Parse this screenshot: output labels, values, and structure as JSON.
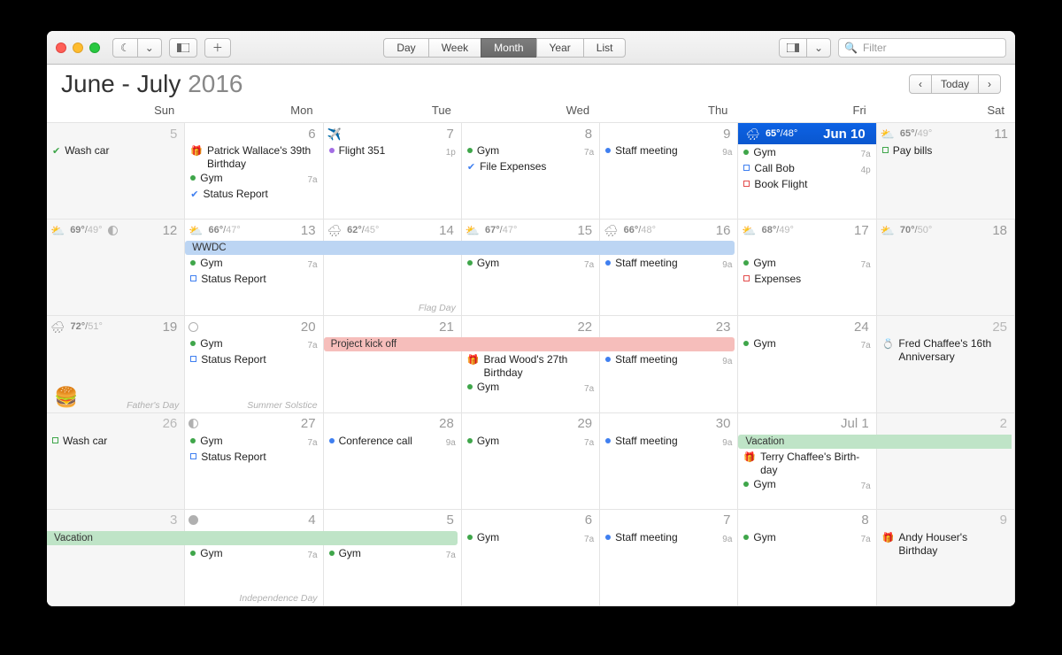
{
  "title": {
    "range": "June - July",
    "year": "2016"
  },
  "toolbar": {
    "views": [
      "Day",
      "Week",
      "Month",
      "Year",
      "List"
    ],
    "active_view": "Month",
    "search_placeholder": "Filter",
    "today_label": "Today"
  },
  "weekdays": [
    "Sun",
    "Mon",
    "Tue",
    "Wed",
    "Thu",
    "Fri",
    "Sat"
  ],
  "colors": {
    "green": "#3fa64a",
    "blue": "#3f7ff0",
    "red": "#e34b4b",
    "purple": "#a36de4",
    "wwdc": "#bcd5f3",
    "project": "#f6bebb",
    "vacation": "#bfe4c7",
    "today": "#0d62e4"
  },
  "spans": {
    "wwdc": {
      "label": "WWDC",
      "week": 1,
      "from": 1,
      "to": 4
    },
    "project": {
      "label": "Project kick off",
      "week": 2,
      "from": 2,
      "to": 4
    },
    "vacation1": {
      "label": "Vacation",
      "week": 3,
      "from": 5,
      "to": 6
    },
    "vacation2": {
      "label": "Vacation",
      "week": 4,
      "from": 0,
      "to": 2
    }
  },
  "weeks": [
    [
      {
        "day": "5",
        "weekend": true,
        "oom": true,
        "events": [
          {
            "k": "chk",
            "c": "green",
            "t": "Wash car"
          }
        ]
      },
      {
        "day": "6",
        "events": [
          {
            "k": "glyph",
            "c": "red",
            "g": "🎁",
            "t": "Patrick Wallace's 39th Birthday"
          },
          {
            "k": "dot",
            "c": "green",
            "t": "Gym",
            "time": "7a"
          },
          {
            "k": "chk",
            "c": "blue",
            "t": "Status Report"
          }
        ]
      },
      {
        "day": "7",
        "headicon": "✈️",
        "events": [
          {
            "k": "dot",
            "c": "purple",
            "t": "Flight 351",
            "time": "1p"
          }
        ]
      },
      {
        "day": "8",
        "events": [
          {
            "k": "dot",
            "c": "green",
            "t": "Gym",
            "time": "7a"
          },
          {
            "k": "chk",
            "c": "blue",
            "t": "File Expenses"
          }
        ]
      },
      {
        "day": "9",
        "events": [
          {
            "k": "dot",
            "c": "blue",
            "t": "Staff meeting",
            "time": "9a"
          }
        ]
      },
      {
        "day": "Jun 10",
        "today": true,
        "weather": "🌧",
        "hi": "65°",
        "lo": "48°",
        "events": [
          {
            "k": "dot",
            "c": "green",
            "t": "Gym",
            "time": "7a"
          },
          {
            "k": "sq",
            "c": "blue",
            "t": "Call Bob",
            "time": "4p"
          },
          {
            "k": "sq",
            "c": "red",
            "t": "Book Flight"
          }
        ]
      },
      {
        "day": "11",
        "weekend": true,
        "weather": "⛅",
        "hi": "65°",
        "lo": "49°",
        "events": [
          {
            "k": "sq",
            "c": "green",
            "t": "Pay bills"
          }
        ]
      }
    ],
    [
      {
        "day": "12",
        "weekend": true,
        "weather": "⛅",
        "hi": "69°",
        "lo": "49°",
        "moon": "half"
      },
      {
        "day": "13",
        "weather": "⛅",
        "hi": "66°",
        "lo": "47°",
        "offset": true,
        "events": [
          {
            "k": "dot",
            "c": "green",
            "t": "Gym",
            "time": "7a"
          },
          {
            "k": "sq",
            "c": "blue",
            "t": "Status Report"
          }
        ]
      },
      {
        "day": "14",
        "weather": "🌧",
        "hi": "62°",
        "lo": "45°",
        "offset": true,
        "foot": "Flag Day"
      },
      {
        "day": "15",
        "weather": "⛅",
        "hi": "67°",
        "lo": "47°",
        "offset": true,
        "events": [
          {
            "k": "dot",
            "c": "green",
            "t": "Gym",
            "time": "7a"
          }
        ]
      },
      {
        "day": "16",
        "weather": "🌧",
        "hi": "66°",
        "lo": "48°",
        "offset": true,
        "events": [
          {
            "k": "dot",
            "c": "blue",
            "t": "Staff meeting",
            "time": "9a"
          }
        ]
      },
      {
        "day": "17",
        "weather": "⛅",
        "hi": "68°",
        "lo": "49°",
        "offset": true,
        "events": [
          {
            "k": "dot",
            "c": "green",
            "t": "Gym",
            "time": "7a"
          },
          {
            "k": "sq",
            "c": "red",
            "t": "Expenses"
          }
        ]
      },
      {
        "day": "18",
        "weekend": true,
        "weather": "⛅",
        "hi": "70°",
        "lo": "50°"
      }
    ],
    [
      {
        "day": "19",
        "weekend": true,
        "weather": "🌧",
        "hi": "72°",
        "lo": "51°",
        "foot": "Father's Day",
        "emoji": "🍔"
      },
      {
        "day": "20",
        "moon": "new",
        "events": [
          {
            "k": "dot",
            "c": "green",
            "t": "Gym",
            "time": "7a"
          },
          {
            "k": "sq",
            "c": "blue",
            "t": "Status Report"
          }
        ],
        "foot": "Summer Solstice"
      },
      {
        "day": "21",
        "offset": true
      },
      {
        "day": "22",
        "offset": true,
        "events": [
          {
            "k": "glyph",
            "c": "red",
            "g": "🎁",
            "t": "Brad Wood's 27th Birthday"
          },
          {
            "k": "dot",
            "c": "green",
            "t": "Gym",
            "time": "7a"
          }
        ]
      },
      {
        "day": "23",
        "offset": true,
        "events": [
          {
            "k": "dot",
            "c": "blue",
            "t": "Staff meeting",
            "time": "9a"
          }
        ]
      },
      {
        "day": "24",
        "events": [
          {
            "k": "dot",
            "c": "green",
            "t": "Gym",
            "time": "7a"
          }
        ]
      },
      {
        "day": "25",
        "weekend": true,
        "oom": true,
        "events": [
          {
            "k": "glyph",
            "c": "red",
            "g": "💍",
            "t": "Fred Chaffee's 16th Anniversary"
          }
        ]
      }
    ],
    [
      {
        "day": "26",
        "weekend": true,
        "oom": true,
        "events": [
          {
            "k": "sq",
            "c": "green",
            "t": "Wash car"
          }
        ]
      },
      {
        "day": "27",
        "moon": "half",
        "events": [
          {
            "k": "dot",
            "c": "green",
            "t": "Gym",
            "time": "7a"
          },
          {
            "k": "sq",
            "c": "blue",
            "t": "Status Report"
          }
        ]
      },
      {
        "day": "28",
        "events": [
          {
            "k": "dot",
            "c": "blue",
            "t": "Conference call",
            "time": "9a"
          }
        ]
      },
      {
        "day": "29",
        "events": [
          {
            "k": "dot",
            "c": "green",
            "t": "Gym",
            "time": "7a"
          }
        ]
      },
      {
        "day": "30",
        "events": [
          {
            "k": "dot",
            "c": "blue",
            "t": "Staff meeting",
            "time": "9a"
          }
        ]
      },
      {
        "day": "Jul 1",
        "offset": true,
        "events": [
          {
            "k": "glyph",
            "c": "red",
            "g": "🎁",
            "t": "Terry Chaffee's Birth­day"
          },
          {
            "k": "dot",
            "c": "green",
            "t": "Gym",
            "time": "7a"
          }
        ]
      },
      {
        "day": "2",
        "weekend": true,
        "oom": true,
        "offset": true
      }
    ],
    [
      {
        "day": "3",
        "weekend": true,
        "oom": true,
        "offset": true
      },
      {
        "day": "4",
        "moon": "full",
        "offset": true,
        "events": [
          {
            "k": "dot",
            "c": "green",
            "t": "Gym",
            "time": "7a"
          }
        ],
        "foot": "Independence Day"
      },
      {
        "day": "5",
        "offset": true,
        "events": [
          {
            "k": "dot",
            "c": "green",
            "t": "Gym",
            "time": "7a"
          }
        ]
      },
      {
        "day": "6",
        "events": [
          {
            "k": "dot",
            "c": "green",
            "t": "Gym",
            "time": "7a"
          }
        ]
      },
      {
        "day": "7",
        "events": [
          {
            "k": "dot",
            "c": "blue",
            "t": "Staff meeting",
            "time": "9a"
          }
        ]
      },
      {
        "day": "8",
        "events": [
          {
            "k": "dot",
            "c": "green",
            "t": "Gym",
            "time": "7a"
          }
        ]
      },
      {
        "day": "9",
        "weekend": true,
        "oom": true,
        "events": [
          {
            "k": "glyph",
            "c": "red",
            "g": "🎁",
            "t": "Andy Houser's Birthday"
          }
        ]
      }
    ]
  ]
}
